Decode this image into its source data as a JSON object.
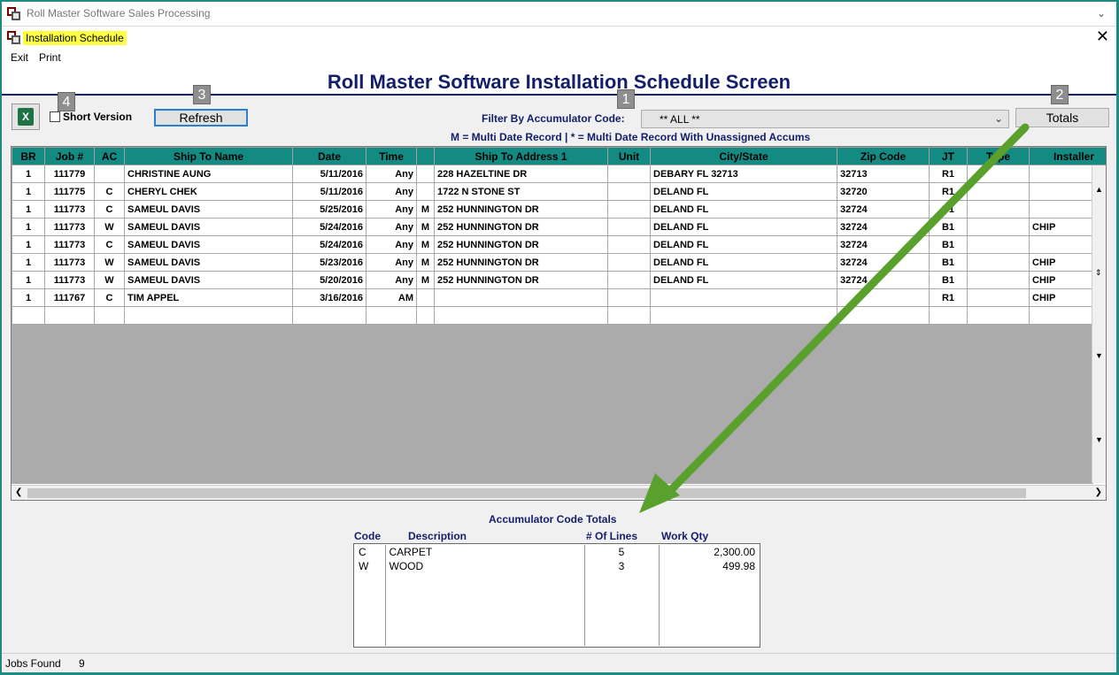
{
  "window": {
    "title": "Roll Master Software Sales Processing"
  },
  "child": {
    "title": "Installation Schedule"
  },
  "menu": {
    "items": [
      "Exit",
      "Print"
    ]
  },
  "screen": {
    "title": "Roll Master Software Installation Schedule Screen"
  },
  "callouts": [
    "1",
    "2",
    "3",
    "4"
  ],
  "toolbar": {
    "short_version_label": "Short Version",
    "refresh_label": "Refresh",
    "filter_label": "Filter By Accumulator Code:",
    "filter_value": "** ALL **",
    "totals_label": "Totals",
    "legend": "M = Multi Date Record | * =  Multi Date Record With Unassigned Accums"
  },
  "grid": {
    "columns": [
      "BR",
      "Job #",
      "AC",
      "Ship To Name",
      "Date",
      "Time",
      "",
      "Ship To Address 1",
      "Unit",
      "City/State",
      "Zip Code",
      "JT",
      "Type",
      "Installer"
    ],
    "rows": [
      [
        "1",
        "111779",
        "",
        "CHRISTINE AUNG",
        "5/11/2016",
        "Any",
        "",
        "228 HAZELTINE DR",
        "",
        "DEBARY FL 32713",
        "32713",
        "R1",
        "",
        ""
      ],
      [
        "1",
        "111775",
        "C",
        "CHERYL CHEK",
        "5/11/2016",
        "Any",
        "",
        "1722 N STONE ST",
        "",
        "DELAND FL",
        "32720",
        "R1",
        "",
        ""
      ],
      [
        "1",
        "111773",
        "C",
        "SAMEUL DAVIS",
        "5/25/2016",
        "Any",
        "M",
        "252 HUNNINGTON DR",
        "",
        "DELAND FL",
        "32724",
        "B1",
        "",
        ""
      ],
      [
        "1",
        "111773",
        "W",
        "SAMEUL DAVIS",
        "5/24/2016",
        "Any",
        "M",
        "252 HUNNINGTON DR",
        "",
        "DELAND FL",
        "32724",
        "B1",
        "",
        "CHIP"
      ],
      [
        "1",
        "111773",
        "C",
        "SAMEUL DAVIS",
        "5/24/2016",
        "Any",
        "M",
        "252 HUNNINGTON DR",
        "",
        "DELAND FL",
        "32724",
        "B1",
        "",
        ""
      ],
      [
        "1",
        "111773",
        "W",
        "SAMEUL DAVIS",
        "5/23/2016",
        "Any",
        "M",
        "252 HUNNINGTON DR",
        "",
        "DELAND FL",
        "32724",
        "B1",
        "",
        "CHIP"
      ],
      [
        "1",
        "111773",
        "W",
        "SAMEUL DAVIS",
        "5/20/2016",
        "Any",
        "M",
        "252 HUNNINGTON DR",
        "",
        "DELAND FL",
        "32724",
        "B1",
        "",
        "CHIP"
      ],
      [
        "1",
        "111767",
        "C",
        "TIM APPEL",
        "3/16/2016",
        "AM",
        "",
        "",
        "",
        "",
        "",
        "R1",
        "",
        "CHIP"
      ],
      [
        "",
        "",
        "",
        "",
        "",
        "",
        "",
        "",
        "",
        "",
        "",
        "",
        "",
        ""
      ]
    ]
  },
  "accumulator": {
    "title": "Accumulator Code Totals",
    "headers": [
      "Code",
      "Description",
      "# Of Lines",
      "Work Qty"
    ],
    "rows": [
      [
        "C",
        "CARPET",
        "5",
        "2,300.00"
      ],
      [
        "W",
        "WOOD",
        "3",
        "499.98"
      ]
    ]
  },
  "status": {
    "label": "Jobs Found",
    "count": "9"
  },
  "colors": {
    "header_teal": "#138a82",
    "title_navy": "#131e6a",
    "highlight": "#ffff44",
    "arrow_green": "#5aa02c",
    "callout_gray": "#8e8e8e"
  }
}
